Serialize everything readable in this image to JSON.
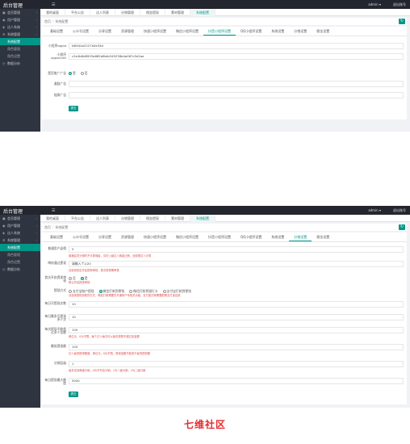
{
  "app": {
    "title": "后台管理",
    "user": "admin ▾",
    "logout": "退出账号"
  },
  "sidebar": {
    "items": [
      {
        "label": "会员管理",
        "icon": "▣"
      },
      {
        "label": "用户管理",
        "icon": "◉"
      },
      {
        "label": "达人系统",
        "icon": "◈"
      },
      {
        "label": "系统管理",
        "icon": "⚙"
      },
      {
        "label": "系统配置",
        "sub": true,
        "active": true
      },
      {
        "label": "角色管理",
        "sub": true
      },
      {
        "label": "角色设置",
        "sub": true
      },
      {
        "label": "数据分析",
        "icon": "◷"
      }
    ]
  },
  "page_tabs": [
    "我的桌面",
    "平台公告",
    "达人列表",
    "分销管理",
    "佣金提现",
    "素材管理",
    "系统配置"
  ],
  "breadcrumb": {
    "home": "首页",
    "current": "系统配置"
  },
  "config_tabs": [
    "基础设置",
    "公众号设置",
    "分享设置",
    "资源管理",
    "快速小程序设置",
    "微信小程序设置",
    "抖音小程序设置",
    "QQ小程序设置",
    "系统设置",
    "分销设置",
    "佣金设置"
  ],
  "shot1": {
    "active_tab": 6,
    "fields": [
      {
        "label": "小程序appid",
        "value": "tt6944a2227a5e34d"
      },
      {
        "label": "小程序appsecret",
        "value": "c2e4b8d8953a685d6bfa349238b4a067c5d2ae"
      }
    ],
    "radio_label": "是否推广广告",
    "radio_opts": [
      "是",
      "否"
    ],
    "input_labels": [
      "激励广告",
      "插屏广告"
    ],
    "submit": "提交"
  },
  "shot2": {
    "active_tab": 9,
    "rows": [
      {
        "label": "普通用户返佣",
        "value": "0",
        "hint": "普通会员分佣时不计算佣金，请勿上级达人佣金比例，全部按达人计算"
      },
      {
        "label": "审核通过提现",
        "value": "请输入个1/20",
        "hint": "请选择是否开启提现审核，首次提现需审核"
      },
      {
        "label": "首次开启提现审核",
        "radio": [
          "否",
          "是"
        ],
        "radio_on": 1,
        "hint": "默认开启提现审核"
      },
      {
        "label": "提现方式",
        "radio": [
          "支付宝账户提现",
          "微信打款到零钱",
          "微信打款到银行卡",
          "支付宝打款到零钱"
        ],
        "radio_on": 1,
        "hint": "请选择提现到账的方式，微信打款需要先开通商户号相关功能，支付宝打款需要配置支付宝应用"
      },
      {
        "label": "每日可提现次数",
        "value": "10"
      },
      {
        "label": "每日最多可提现多少次",
        "value": "10"
      },
      {
        "label": "每次提现不能超过多少金额",
        "value": "100",
        "hint": "单位元，0为不限，每个达人每次可以最多提现不超过该金额"
      },
      {
        "label": "最低提现额",
        "value": "100",
        "hint": "达人最低提现额度，单位元，0为不限，提现金额不能低于最低提现额"
      },
      {
        "label": "分销层级",
        "value": "1",
        "hint": "最多支持两级分销，0为不开启分销，1为一级分销，2为二级分销"
      },
      {
        "label": "每日提现最大额度",
        "value": "5000"
      }
    ],
    "submit": "提交"
  },
  "watermark": "七维社区"
}
